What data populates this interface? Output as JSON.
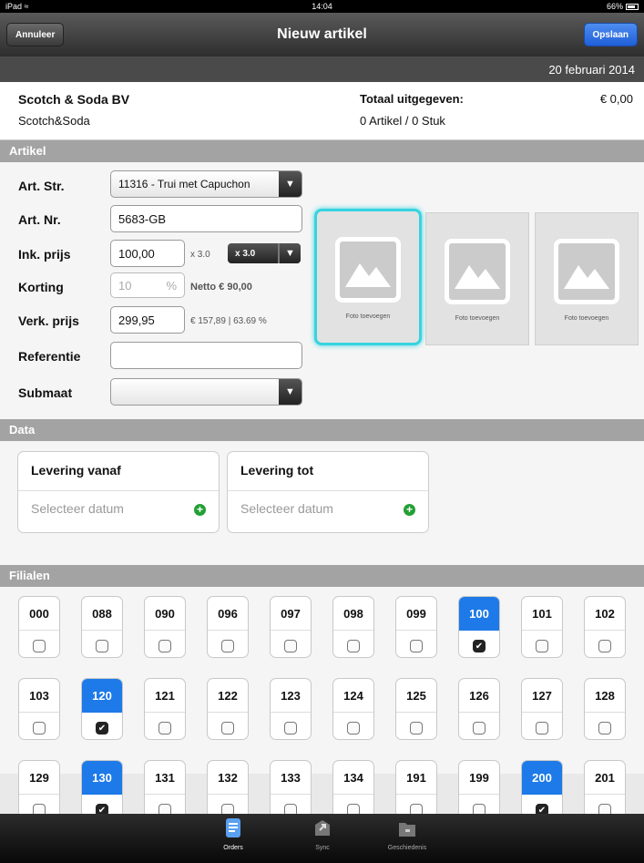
{
  "status": {
    "device": "iPad ≈",
    "time": "14:04",
    "battery": "66%"
  },
  "nav": {
    "cancel": "Annuleer",
    "title": "Nieuw artikel",
    "save": "Opslaan"
  },
  "date": "20 februari 2014",
  "header": {
    "company": "Scotch & Soda BV",
    "brand": "Scotch&Soda",
    "total_label": "Totaal uitgegeven:",
    "total_value": "€ 0,00",
    "count": "0 Artikel / 0 Stuk"
  },
  "sections": {
    "artikel": "Artikel",
    "data": "Data",
    "filialen": "Filialen"
  },
  "form": {
    "art_str": {
      "label": "Art. Str.",
      "value": "11316 - Trui met Capuchon"
    },
    "art_nr": {
      "label": "Art. Nr.",
      "value": "5683-GB"
    },
    "ink": {
      "label": "Ink. prijs",
      "value": "100,00",
      "mult_text": "x 3.0",
      "mult_btn": "x 3.0"
    },
    "korting": {
      "label": "Korting",
      "placeholder": "10",
      "pct": "%",
      "netto": "Netto € 90,00"
    },
    "verk": {
      "label": "Verk. prijs",
      "value": "299,95",
      "info": "€ 157,89 | 63.69 %"
    },
    "ref": {
      "label": "Referentie",
      "value": ""
    },
    "submaat": {
      "label": "Submaat",
      "value": ""
    }
  },
  "photos": [
    {
      "caption": "Foto toevoegen"
    },
    {
      "caption": "Foto toevoegen"
    },
    {
      "caption": "Foto toevoegen"
    }
  ],
  "data": {
    "from": {
      "title": "Levering vanaf",
      "placeholder": "Selecteer datum"
    },
    "to": {
      "title": "Levering tot",
      "placeholder": "Selecteer datum"
    }
  },
  "branches": [
    {
      "code": "000",
      "checked": false
    },
    {
      "code": "088",
      "checked": false
    },
    {
      "code": "090",
      "checked": false
    },
    {
      "code": "096",
      "checked": false
    },
    {
      "code": "097",
      "checked": false
    },
    {
      "code": "098",
      "checked": false
    },
    {
      "code": "099",
      "checked": false
    },
    {
      "code": "100",
      "checked": true
    },
    {
      "code": "101",
      "checked": false
    },
    {
      "code": "102",
      "checked": false
    },
    {
      "code": "103",
      "checked": false
    },
    {
      "code": "120",
      "checked": true
    },
    {
      "code": "121",
      "checked": false
    },
    {
      "code": "122",
      "checked": false
    },
    {
      "code": "123",
      "checked": false
    },
    {
      "code": "124",
      "checked": false
    },
    {
      "code": "125",
      "checked": false
    },
    {
      "code": "126",
      "checked": false
    },
    {
      "code": "127",
      "checked": false
    },
    {
      "code": "128",
      "checked": false
    },
    {
      "code": "129",
      "checked": false
    },
    {
      "code": "130",
      "checked": true
    },
    {
      "code": "131",
      "checked": false
    },
    {
      "code": "132",
      "checked": false
    },
    {
      "code": "133",
      "checked": false
    },
    {
      "code": "134",
      "checked": false
    },
    {
      "code": "191",
      "checked": false
    },
    {
      "code": "199",
      "checked": false
    },
    {
      "code": "200",
      "checked": true
    },
    {
      "code": "201",
      "checked": false
    }
  ],
  "tabs": [
    {
      "label": "Orders",
      "icon": "orders-icon",
      "active": true
    },
    {
      "label": "Sync",
      "icon": "sync-icon",
      "active": false
    },
    {
      "label": "Geschiedenis",
      "icon": "folder-icon",
      "active": false
    }
  ],
  "colors": {
    "accent": "#1e7ae8",
    "highlight": "#38d3e0",
    "add": "#23a034"
  }
}
